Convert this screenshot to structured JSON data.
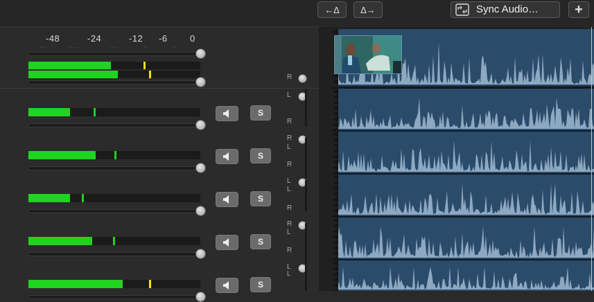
{
  "toolbar": {
    "nudge_left_label": "←∆",
    "nudge_right_label": "∆→",
    "sync_label": "Sync Audio…",
    "sync_icon": "sync-audio-icon",
    "add_label": "+"
  },
  "master_scale": {
    "ticks": [
      "-48",
      "-24",
      "-12",
      "-6",
      "0"
    ]
  },
  "master": {
    "fader_level": 1.0,
    "meters": [
      {
        "level": 0.48,
        "peak": 0.67
      },
      {
        "level": 0.52,
        "peak": 0.7
      }
    ]
  },
  "channels": [
    {
      "level": 0.24,
      "peak": 0.38,
      "fader": 1.0,
      "solo_label": "S",
      "mute_icon": "speaker-icon"
    },
    {
      "level": 0.39,
      "peak": 0.5,
      "fader": 1.0,
      "solo_label": "S",
      "mute_icon": "speaker-icon"
    },
    {
      "level": 0.24,
      "peak": 0.31,
      "fader": 1.0,
      "solo_label": "S",
      "mute_icon": "speaker-icon"
    },
    {
      "level": 0.37,
      "peak": 0.49,
      "fader": 1.0,
      "solo_label": "S",
      "mute_icon": "speaker-icon"
    },
    {
      "level": 0.55,
      "peak": 0.7,
      "fader": 1.0,
      "solo_label": "S",
      "mute_icon": "speaker-icon"
    }
  ],
  "pan_labels": {
    "left": "L",
    "right": "R"
  },
  "colors": {
    "meter_green": "#1fd41f",
    "peak_green": "#1fd41f",
    "peak_yellow": "#f2e21a",
    "lane_blue": "#2b4b6a",
    "waveform": "#9fb8d0"
  }
}
